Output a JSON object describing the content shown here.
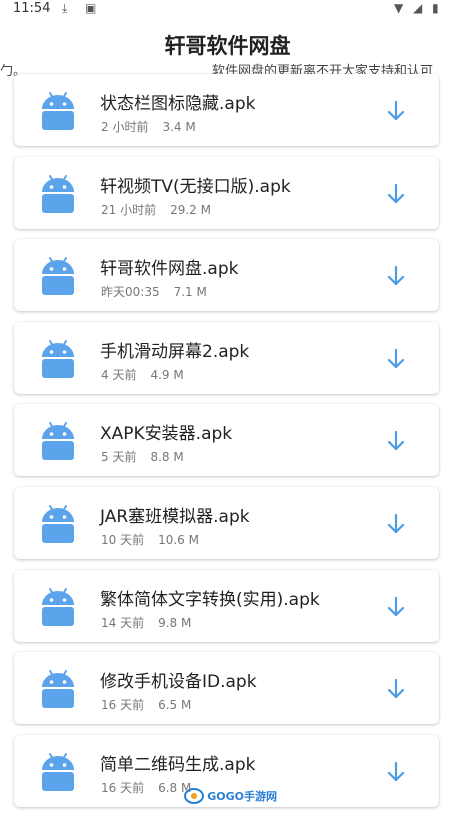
{
  "status_bar": {
    "time": "11:54"
  },
  "header": {
    "title": "轩哥软件网盘",
    "marquee_left": "勹。",
    "marquee_right": "软件网盘的更新离不开大家支持和认可"
  },
  "files": [
    {
      "name": "状态栏图标隐藏.apk",
      "time": "2 小时前",
      "size": "3.4 M"
    },
    {
      "name": "轩视频TV(无接口版).apk",
      "time": "21 小时前",
      "size": "29.2 M"
    },
    {
      "name": "轩哥软件网盘.apk",
      "time": "昨天00:35",
      "size": "7.1 M"
    },
    {
      "name": "手机滑动屏幕2.apk",
      "time": "4 天前",
      "size": "4.9 M"
    },
    {
      "name": "XAPK安装器.apk",
      "time": "5 天前",
      "size": "8.8 M"
    },
    {
      "name": "JAR塞班模拟器.apk",
      "time": "10 天前",
      "size": "10.6 M"
    },
    {
      "name": "繁体简体文字转换(实用).apk",
      "time": "14 天前",
      "size": "9.8 M"
    },
    {
      "name": "修改手机设备ID.apk",
      "time": "16 天前",
      "size": "6.5 M"
    },
    {
      "name": "简单二维码生成.apk",
      "time": "16 天前",
      "size": "6.8 M"
    }
  ],
  "colors": {
    "accent": "#4a9be8",
    "android_icon": "#5ba3ea"
  },
  "icons": {
    "app": "android-icon",
    "download": "download-arrow-icon"
  },
  "watermark": {
    "text": "GOGO手游网"
  }
}
